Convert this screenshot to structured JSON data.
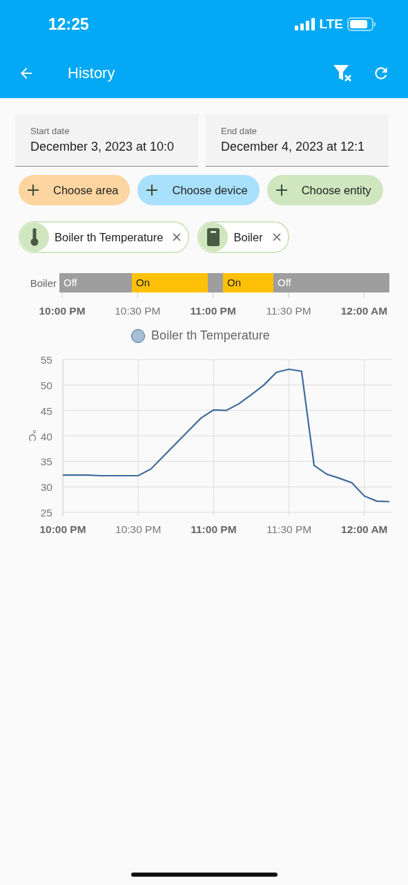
{
  "status_bar": {
    "time": "12:25",
    "network": "LTE"
  },
  "app_bar": {
    "title": "History"
  },
  "date_fields": [
    {
      "label": "Start date",
      "value": "December 3, 2023 at 10:0"
    },
    {
      "label": "End date",
      "value": "December 4, 2023 at 12:1"
    }
  ],
  "pickers": [
    {
      "label": "Choose area",
      "color": "#fdd5a0"
    },
    {
      "label": "Choose device",
      "color": "#a9e0fb"
    },
    {
      "label": "Choose entity",
      "color": "#cfe6bf"
    }
  ],
  "selected_entities": [
    {
      "kind": "thermometer",
      "label": "Boiler th Temperature"
    },
    {
      "kind": "device",
      "label": "Boiler"
    }
  ],
  "timeline": {
    "name": "Boiler",
    "segments": [
      {
        "kind": "off",
        "label": "Off"
      },
      {
        "kind": "on",
        "label": "On"
      },
      {
        "kind": "off"
      },
      {
        "kind": "on",
        "label": "On"
      },
      {
        "kind": "off",
        "label": "Off"
      }
    ],
    "ticks": [
      {
        "label": "10:00 PM",
        "major": true
      },
      {
        "label": "10:30 PM",
        "major": false
      },
      {
        "label": "11:00 PM",
        "major": true
      },
      {
        "label": "11:30 PM",
        "major": false
      },
      {
        "label": "12:00 AM",
        "major": true
      }
    ]
  },
  "chart": {
    "chart_data": {
      "type": "line",
      "grid": true,
      "ylabel": "°C",
      "ylim": [
        25,
        55
      ],
      "categories": [
        "10:00 PM",
        null,
        null,
        null,
        null,
        null,
        "10:30 PM",
        null,
        null,
        null,
        null,
        null,
        "11:00 PM",
        null,
        null,
        null,
        null,
        null,
        "11:30 PM",
        null,
        null,
        null,
        null,
        null,
        "12:00 AM",
        null,
        null
      ],
      "yticks": [
        25,
        30,
        35,
        40,
        45,
        50,
        55
      ],
      "series": [
        {
          "name": "Boiler th Temperature",
          "color": "#3e6b9a",
          "values": [
            32.3,
            32.3,
            32.3,
            32.2,
            32.2,
            32.2,
            32.2,
            33.5,
            36,
            38.5,
            41,
            43.5,
            45.1,
            45,
            46.3,
            48.1,
            50,
            52.5,
            53.1,
            52.7,
            34.2,
            32.5,
            31.7,
            30.8,
            28.2,
            27.2,
            27.1
          ]
        }
      ]
    }
  }
}
